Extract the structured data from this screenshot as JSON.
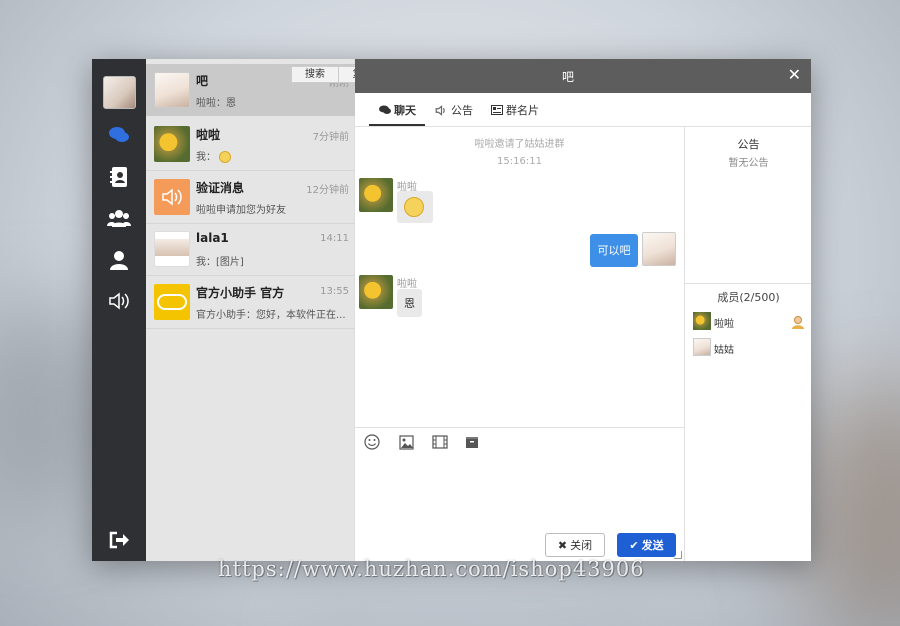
{
  "nav": {
    "icons": [
      "chat-icon",
      "contacts-icon",
      "group-icon",
      "user-icon",
      "speaker-icon",
      "logout-icon"
    ],
    "active_color": "#2f6fe0"
  },
  "context_menu": {
    "search": "搜索",
    "copy": "复制"
  },
  "conversations": [
    {
      "name": "吧",
      "time": "刚刚",
      "last": "啦啦：恩",
      "avatar": "anime-boy"
    },
    {
      "name": "啦啦",
      "time": "7分钟前",
      "last": "我：",
      "avatar": "sunflower"
    },
    {
      "name": "验证消息",
      "time": "12分钟前",
      "last": "啦啦申请加您为好友",
      "avatar": "speaker"
    },
    {
      "name": "lala1",
      "time": "14:11",
      "last": "我：[图片]",
      "avatar": "anime-girl"
    },
    {
      "name": "官方小助手 官方",
      "time": "13:55",
      "last": "官方小助手：您好，本软件正在...",
      "avatar": "itel"
    }
  ],
  "chat": {
    "title": "吧",
    "tabs": [
      "聊天",
      "公告",
      "群名片"
    ],
    "system_message": "啦啦邀请了姑姑进群",
    "timestamp": "15:16:11",
    "messages": [
      {
        "from": "啦啦",
        "side": "left",
        "text": ""
      },
      {
        "from": "",
        "side": "right",
        "text": "可以吧"
      },
      {
        "from": "啦啦",
        "side": "left",
        "text": "恩"
      }
    ]
  },
  "composer": {
    "close_label": "关闭",
    "send_label": "发送"
  },
  "side": {
    "notice_title": "公告",
    "notice_empty": "暂无公告",
    "members_title": "成员(2/500)",
    "members": [
      {
        "name": "啦啦"
      },
      {
        "name": "姑姑"
      }
    ]
  },
  "watermark": "https://www.huzhan.com/ishop43906"
}
